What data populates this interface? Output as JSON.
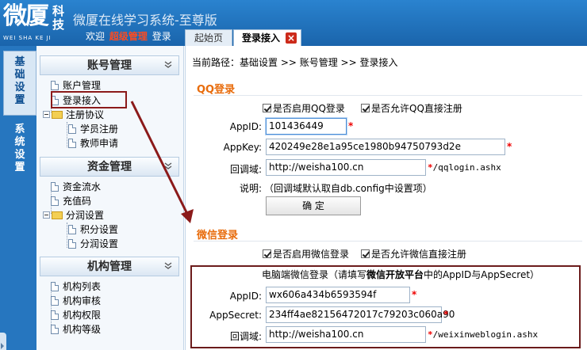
{
  "header": {
    "logo_main": "微厦",
    "logo_side": "科技",
    "logo_sub": "WEI SHA KE JI",
    "system_title": "微厦在线学习系统-至尊版",
    "welcome": "欢迎",
    "role": "超级管理",
    "login": "登录",
    "tabs": [
      {
        "label": "起始页"
      },
      {
        "label": "登录接入"
      }
    ]
  },
  "strip": {
    "base": [
      "基",
      "础",
      "设",
      "置"
    ],
    "sys": [
      "系",
      "统",
      "设",
      "置"
    ]
  },
  "sidebar": {
    "sections": [
      {
        "title": "账号管理",
        "items": [
          "账户管理",
          "登录接入"
        ],
        "folder": "注册协议",
        "sub": [
          "学员注册",
          "教师申请"
        ]
      },
      {
        "title": "资金管理",
        "items": [
          "资金流水",
          "充值码"
        ],
        "folder": "分润设置",
        "sub": [
          "积分设置",
          "分润设置"
        ]
      },
      {
        "title": "机构管理",
        "items": [
          "机构列表",
          "机构审核",
          "机构权限",
          "机构等级"
        ]
      }
    ]
  },
  "breadcrumb": "当前路径：基础设置 >> 账号管理 >> 登录接入",
  "qq": {
    "title": "QQ登录",
    "enable_label": "是否启用QQ登录",
    "direct_label": "是否允许QQ直接注册",
    "appid_label": "AppID:",
    "appid_value": "101436449",
    "appkey_label": "AppKey:",
    "appkey_value": "420249e28e1a95ce1980b94750793d2e",
    "callback_label": "回调域:",
    "callback_value": "http://weisha100.cn",
    "callback_suffix": "/qqlogin.ashx",
    "note_label": "说明:",
    "note_text": "（回调域默认取自db.config中设置项）",
    "confirm_label": "确  定"
  },
  "wechat": {
    "title": "微信登录",
    "enable_label": "是否启用微信登录",
    "direct_label": "是否允许微信直接注册",
    "head_prefix": "电脑端微信登录（请填写",
    "head_bold": "微信开放平台",
    "head_suffix": "中的AppID与AppSecret）",
    "appid_label": "AppID:",
    "appid_value": "wx606a434b6593594f",
    "secret_label": "AppSecret:",
    "secret_value": "234ff4ae82156472017c79203c060a90",
    "callback_label": "回调域:",
    "callback_value": "http://weisha100.cn",
    "callback_suffix": "/weixinweblogin.ashx"
  },
  "colors": {
    "header": "#1f6fb8",
    "accent_orange": "#e86c0c",
    "highlight_border": "#8b1a1a"
  }
}
